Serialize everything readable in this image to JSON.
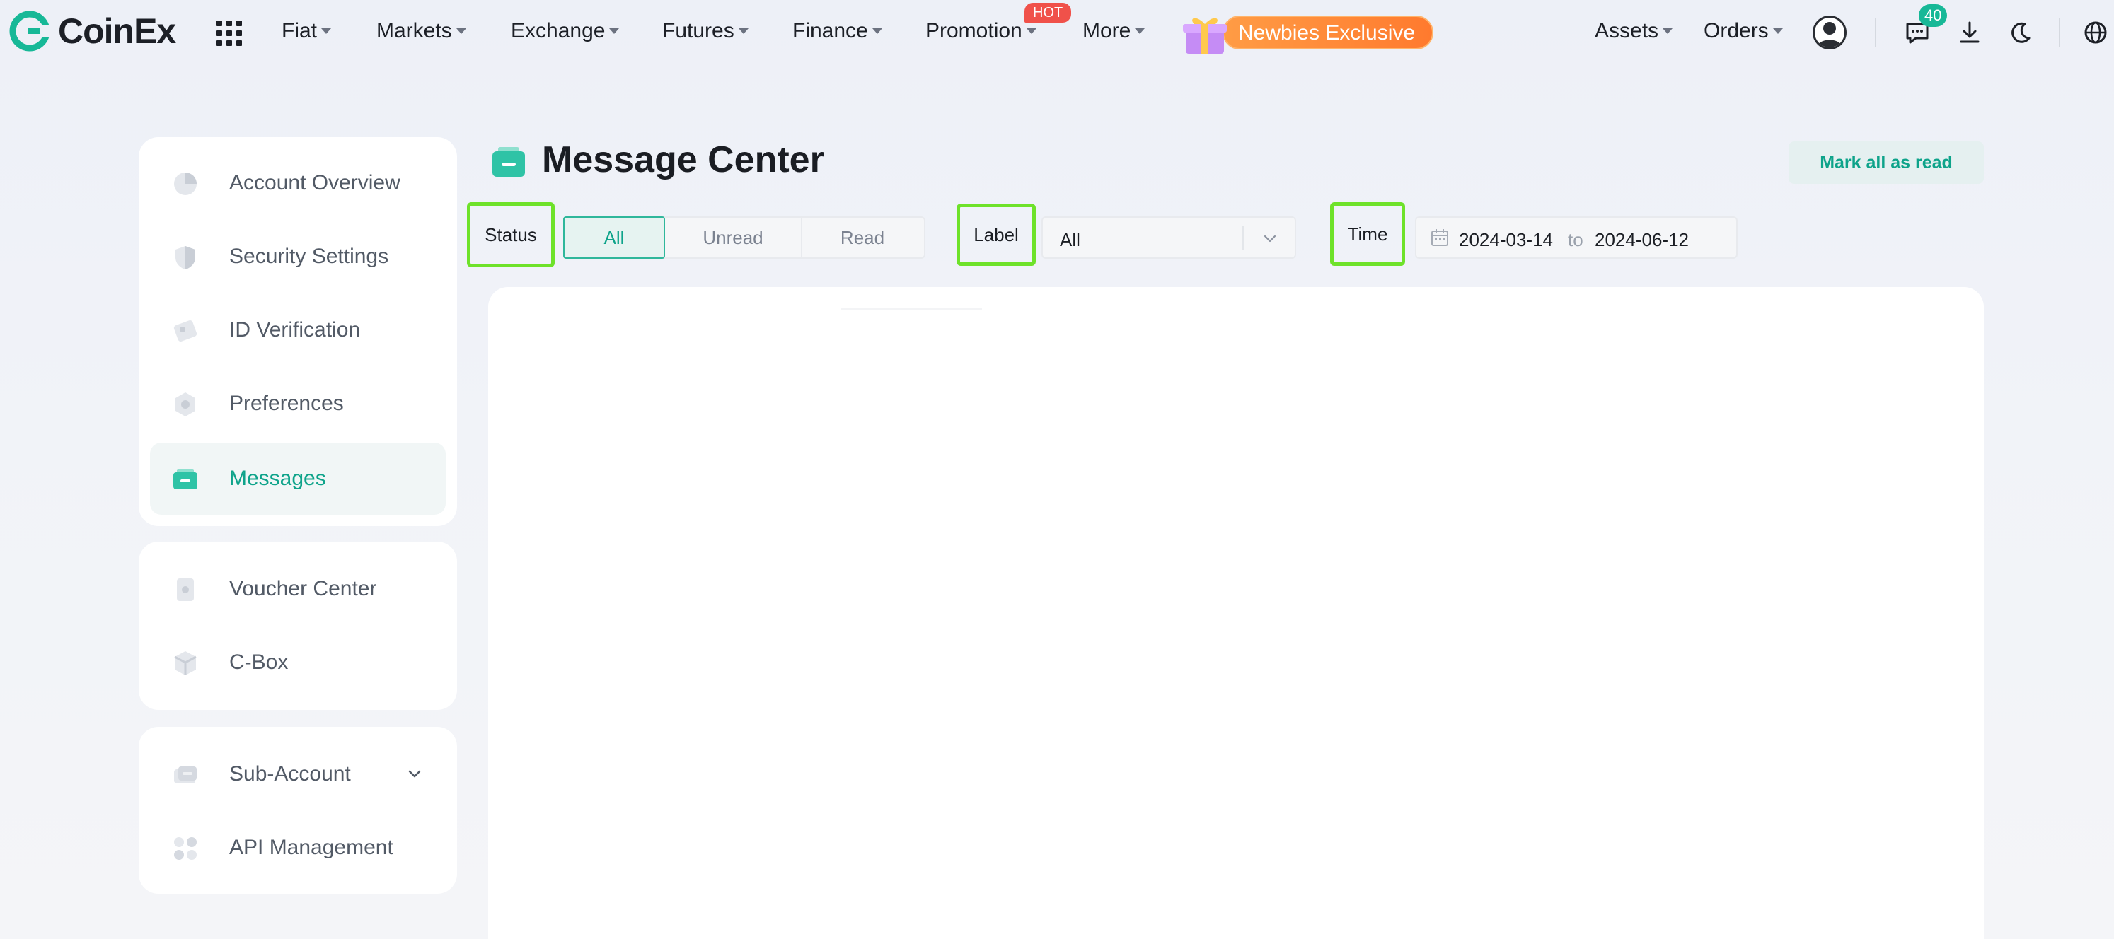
{
  "nav": {
    "brand": "CoinEx",
    "items": [
      {
        "label": "Fiat"
      },
      {
        "label": "Markets"
      },
      {
        "label": "Exchange"
      },
      {
        "label": "Futures"
      },
      {
        "label": "Finance"
      },
      {
        "label": "Promotion"
      },
      {
        "label": "More"
      }
    ],
    "hot_badge": "HOT",
    "promo_label": "Newbies Exclusive",
    "assets_label": "Assets",
    "orders_label": "Orders",
    "message_count": "40"
  },
  "sidebar": {
    "groups": [
      [
        {
          "label": "Account Overview"
        },
        {
          "label": "Security Settings"
        },
        {
          "label": "ID Verification"
        },
        {
          "label": "Preferences"
        },
        {
          "label": "Messages"
        }
      ],
      [
        {
          "label": "Voucher Center"
        },
        {
          "label": "C-Box"
        }
      ],
      [
        {
          "label": "Sub-Account"
        },
        {
          "label": "API Management"
        }
      ]
    ],
    "active_item": "Messages"
  },
  "main": {
    "title": "Message Center",
    "mark_all_read": "Mark all as read",
    "filters": {
      "status_label": "Status",
      "status_options": [
        "All",
        "Unread",
        "Read"
      ],
      "status_selected": "All",
      "label_label": "Label",
      "label_value": "All",
      "time_label": "Time",
      "date_from": "2024-03-14",
      "date_sep": "to",
      "date_to": "2024-06-12"
    }
  },
  "colors": {
    "accent": "#0ea38a",
    "highlight": "#6ee22a",
    "promo": "#ff8a3a",
    "hot": "#f0514a"
  }
}
